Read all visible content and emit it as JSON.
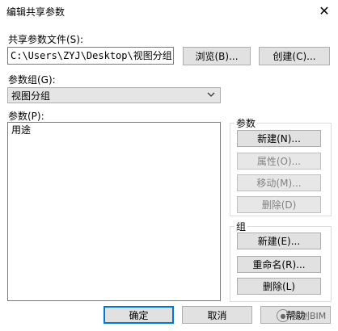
{
  "window": {
    "title": "编辑共享参数",
    "close_glyph": "✕"
  },
  "shared_file": {
    "label": "共享参数文件(S):",
    "path": "C:\\Users\\ZYJ\\Desktop\\视图分组.txt",
    "browse_label": "浏览(B)...",
    "create_label": "创建(C)..."
  },
  "param_group": {
    "label": "参数组(G):",
    "selected": "视图分组"
  },
  "params": {
    "label": "参数(P):",
    "items": [
      "用途"
    ]
  },
  "param_box": {
    "title": "参数",
    "new_label": "新建(N)...",
    "properties_label": "属性(O)...",
    "move_label": "移动(M)...",
    "delete_label": "删除(D)"
  },
  "group_box": {
    "title": "组",
    "new_label": "新建(E)...",
    "rename_label": "重命名(R)...",
    "delete_label": "删除(L)"
  },
  "footer": {
    "ok_label": "确定",
    "cancel_label": "取消",
    "help_label": "帮助"
  },
  "watermark": {
    "text": "智创BIM"
  }
}
